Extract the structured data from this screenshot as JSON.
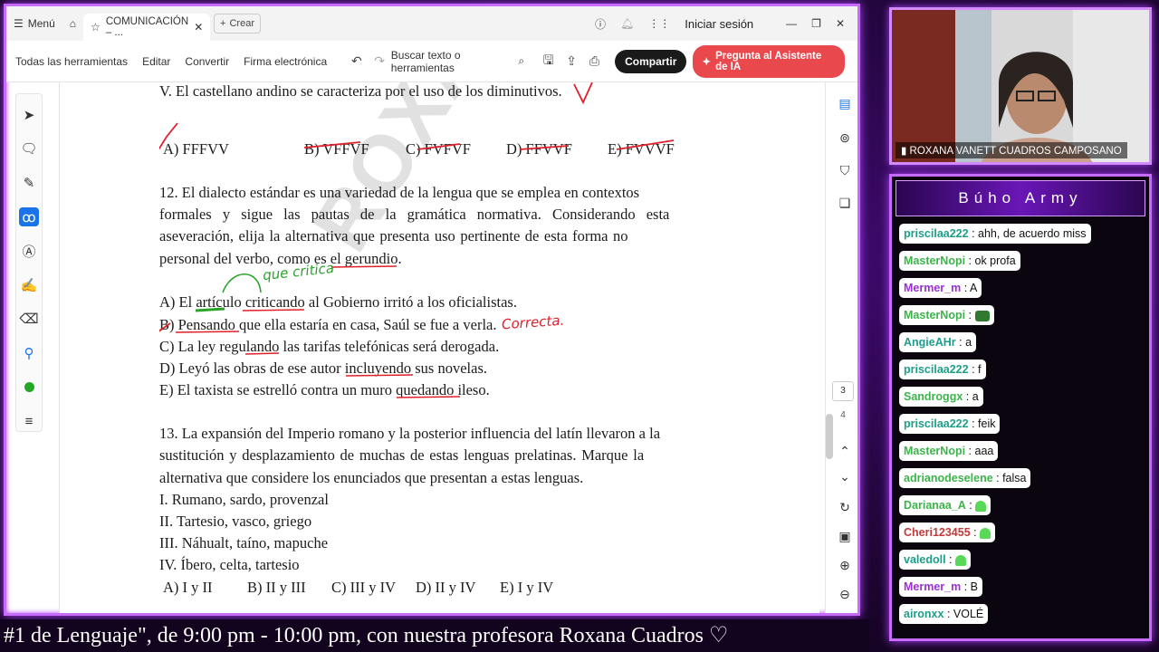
{
  "tabbar": {
    "menu_label": "Menú",
    "tab_title": "COMUNICACIÓN – ...",
    "new_tab_label": "Crear",
    "signin_label": "Iniciar sesión"
  },
  "toolbar": {
    "items": [
      "Todas las herramientas",
      "Editar",
      "Convertir",
      "Firma electrónica"
    ],
    "search_label": "Buscar texto o herramientas",
    "share_label": "Compartir",
    "ai_label": "Pregunta al Asistente de IA"
  },
  "document": {
    "statement_v": "V. El castellano andino se caracteriza por el uso de los diminutivos.",
    "q11_options": [
      "A) FFFVV",
      "B) VFFVF",
      "C) FVFVF",
      "D) FFVVF",
      "E) FVVVF"
    ],
    "q12_lines": [
      "12. El dialecto estándar es una variedad de la lengua que se emplea en contextos",
      "formales y sigue las pautas de la gramática normativa. Considerando esta",
      "aseveración, elija la alternativa que presenta uso pertinente de esta forma no",
      "personal del verbo, como es el gerundio."
    ],
    "q12_options": [
      "A) El artículo criticando al Gobierno irritó a los oficialistas.",
      "B) Pensando que ella estaría en casa, Saúl se fue a verla.",
      "C) La ley regulando las tarifas telefónicas será derogada.",
      "D) Leyó las obras de ese autor incluyendo sus novelas.",
      "E) El taxista se estrelló contra un muro quedando ileso."
    ],
    "q13_lines": [
      "13. La expansión del Imperio romano y la posterior influencia del latín llevaron a la",
      "sustitución y desplazamiento de muchas de estas lenguas prelatinas. Marque la",
      "alternativa que considere los enunciados que presentan a estas lenguas."
    ],
    "q13_items": [
      "I. Rumano, sardo, provenzal",
      "II. Tartesio, vasco, griego",
      "III. Náhualt, taíno, mapuche",
      "IV. Íbero, celta, tartesio"
    ],
    "q13_options": [
      "A) I y II",
      "B) II y III",
      "C) III y IV",
      "D) II y IV",
      "E) I y IV"
    ],
    "watermark": "ROXANA",
    "handwritten_note_1": "que critica",
    "handwritten_note_2": "Correcta."
  },
  "pager": {
    "current": "3",
    "next": "4"
  },
  "webcam": {
    "name": "ROXANA VANETT CUADROS CAMPOSANO"
  },
  "chat": {
    "title": "Búho Army",
    "messages": [
      {
        "user": "priscilaa222",
        "text": "ahh, de acuerdo miss",
        "color": "#1e9e8a"
      },
      {
        "user": "MasterNopi",
        "text": "ok profa",
        "color": "#3cb44b"
      },
      {
        "user": "Mermer_m",
        "text": "A",
        "color": "#9b30d9"
      },
      {
        "user": "MasterNopi",
        "text": "",
        "color": "#3cb44b",
        "emote": "snake"
      },
      {
        "user": "AngieAHr",
        "text": "a",
        "color": "#1e9e8a"
      },
      {
        "user": "priscilaa222",
        "text": "f",
        "color": "#1e9e8a"
      },
      {
        "user": "Sandroggx",
        "text": "a",
        "color": "#3cb44b"
      },
      {
        "user": "priscilaa222",
        "text": "feik",
        "color": "#1e9e8a"
      },
      {
        "user": "MasterNopi",
        "text": "aaa",
        "color": "#3cb44b"
      },
      {
        "user": "adrianodeselene",
        "text": "falsa",
        "color": "#3cb44b"
      },
      {
        "user": "Darianaa_A",
        "text": "",
        "color": "#3cb44b",
        "emote": "ghost"
      },
      {
        "user": "Cheri123455",
        "text": "",
        "color": "#c23a3a",
        "emote": "ghost"
      },
      {
        "user": "valedoll",
        "text": "",
        "color": "#1e9e8a",
        "emote": "ghost"
      },
      {
        "user": "Mermer_m",
        "text": "B",
        "color": "#9b30d9"
      },
      {
        "user": "aironxx",
        "text": "VOLÉ",
        "color": "#1e9e8a"
      }
    ]
  },
  "ticker": "#1 de Lenguaje\", de 9:00 pm - 10:00 pm, con nuestra profesora Roxana Cuadros ♡",
  "colors": {
    "accent": "#c76bff",
    "share": "#1a1a1a",
    "ai": "#e9484d",
    "pen": "#e0202a",
    "green_pen": "#2aa52a"
  }
}
